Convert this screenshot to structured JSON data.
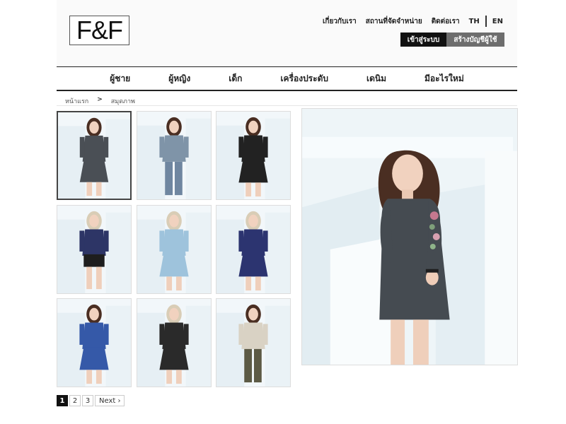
{
  "brand": {
    "logo_text": "F&F"
  },
  "header": {
    "links": [
      "เกี่ยวกับเรา",
      "สถานที่จัดจำหน่าย",
      "ติดต่อเรา"
    ],
    "lang_th": "TH",
    "lang_en": "EN",
    "login_label": "เข้าสู่ระบบ",
    "register_label": "สร้างบัญชีผู้ใช้"
  },
  "nav": {
    "items": [
      "ผู้ชาย",
      "ผู้หญิง",
      "เด็ก",
      "เครื่องประดับ",
      "เดนิม",
      "มีอะไรใหม่"
    ]
  },
  "breadcrumb": {
    "home": "หน้าแรก",
    "separator": ">",
    "current": "สมุดภาพ"
  },
  "gallery": {
    "thumbnails": [
      {
        "name": "grey-embroidered-dress",
        "hair": "brunette",
        "top": "#4a4f55",
        "bottom": "#4a4f55",
        "style": "dress",
        "active": true
      },
      {
        "name": "denim-top-jeans",
        "hair": "brunette",
        "top": "#7f94a8",
        "bottom": "#6f86a0",
        "style": "pants",
        "active": false
      },
      {
        "name": "black-floral-dress",
        "hair": "brunette",
        "top": "#222222",
        "bottom": "#222222",
        "style": "dress",
        "active": false
      },
      {
        "name": "navy-top-black-shorts",
        "hair": "blonde",
        "top": "#2d3566",
        "bottom": "#1e1e1e",
        "style": "shorts",
        "active": false
      },
      {
        "name": "light-blue-dress",
        "hair": "blonde",
        "top": "#9ec3dc",
        "bottom": "#9ec3dc",
        "style": "dress",
        "active": false
      },
      {
        "name": "navy-floral-dress",
        "hair": "blonde",
        "top": "#2c3470",
        "bottom": "#2c3470",
        "style": "dress",
        "active": false
      },
      {
        "name": "blue-floral-dress",
        "hair": "brunette",
        "top": "#3559a8",
        "bottom": "#3559a8",
        "style": "dress",
        "active": false
      },
      {
        "name": "black-dress",
        "hair": "blonde",
        "top": "#2a2a2a",
        "bottom": "#2a2a2a",
        "style": "dress",
        "active": false
      },
      {
        "name": "floral-top-olive-pants",
        "hair": "brunette",
        "top": "#d9d2c4",
        "bottom": "#5c5a45",
        "style": "pants",
        "active": false
      }
    ],
    "main_image": {
      "name": "grey-embroidered-dress-large"
    }
  },
  "pagination": {
    "pages": [
      "1",
      "2",
      "3"
    ],
    "current": "1",
    "next_label": "Next ›"
  },
  "colors": {
    "header_bg": "#fafafa",
    "accent_dark": "#111111",
    "accent_grey": "#6d6d6d"
  }
}
